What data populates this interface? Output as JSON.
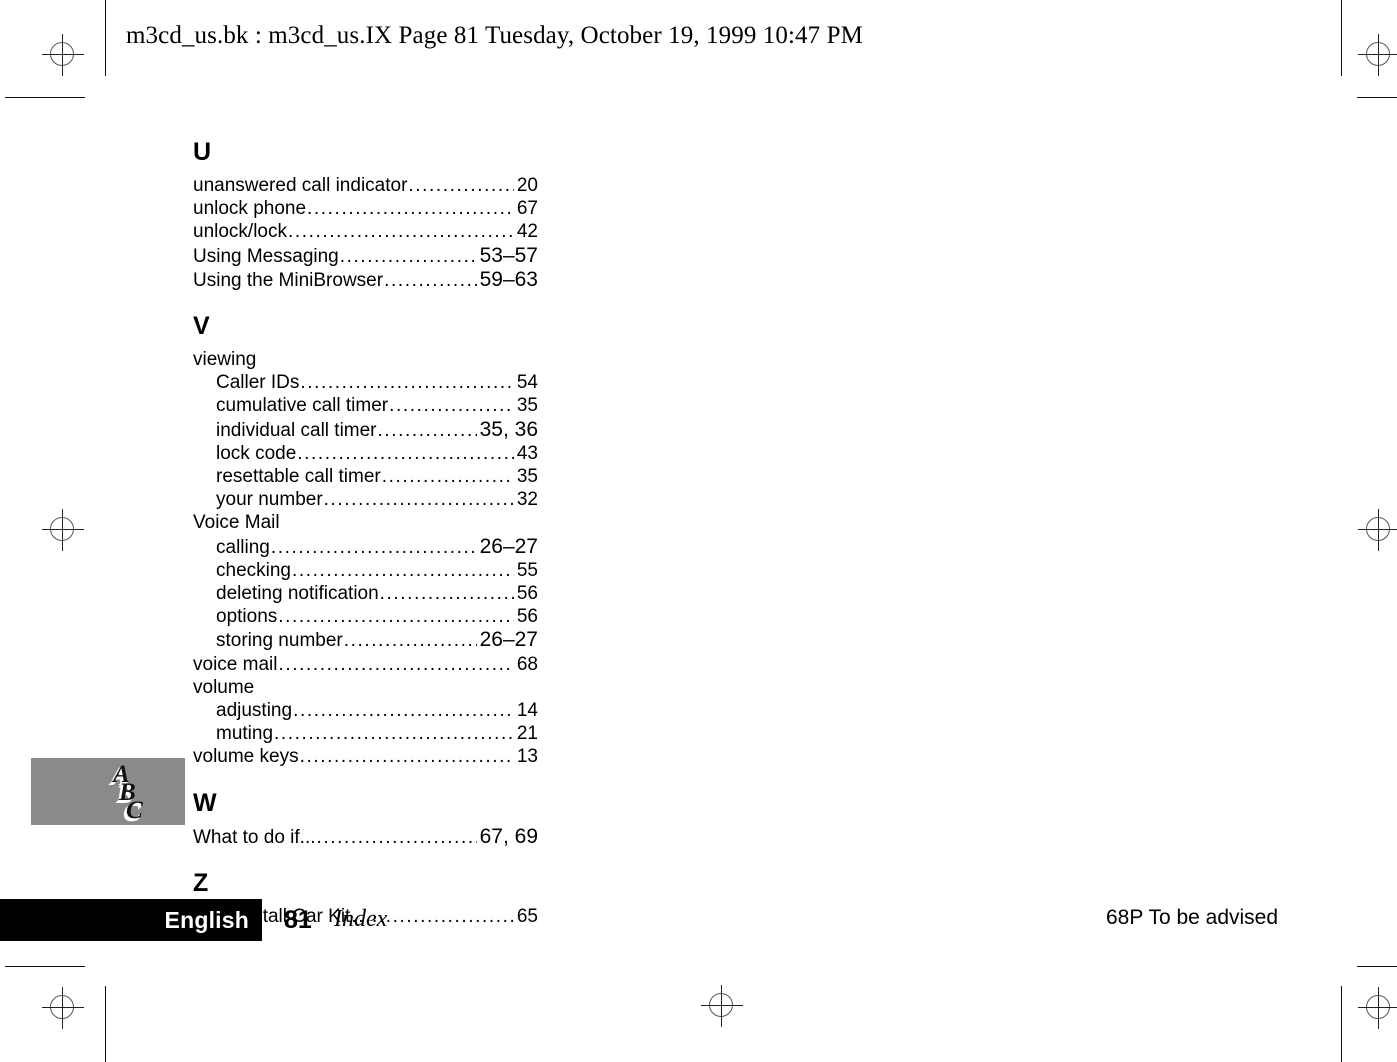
{
  "header": {
    "slug": "m3cd_us.bk : m3cd_us.IX  Page 81  Tuesday, October 19, 1999  10:47 PM"
  },
  "index": {
    "sections": [
      {
        "letter": "U",
        "entries": [
          {
            "text": "unanswered call indicator",
            "pages": "20",
            "level": 0,
            "range": false
          },
          {
            "text": "unlock phone",
            "pages": "67",
            "level": 0,
            "range": false
          },
          {
            "text": "unlock/lock",
            "pages": "42",
            "level": 0,
            "range": false
          },
          {
            "text": "Using Messaging",
            "pages": "53–57",
            "level": 0,
            "range": true
          },
          {
            "text": "Using the MiniBrowser",
            "pages": "59–63",
            "level": 0,
            "range": true
          }
        ]
      },
      {
        "letter": "V",
        "entries": [
          {
            "text": "viewing",
            "pages": "",
            "level": 0,
            "range": false
          },
          {
            "text": "Caller IDs",
            "pages": "54",
            "level": 1,
            "range": false
          },
          {
            "text": "cumulative call timer",
            "pages": "35",
            "level": 1,
            "range": false
          },
          {
            "text": "individual call timer",
            "pages": "35, 36",
            "level": 1,
            "range": true
          },
          {
            "text": "lock code",
            "pages": "43",
            "level": 1,
            "range": false
          },
          {
            "text": "resettable call timer",
            "pages": "35",
            "level": 1,
            "range": false
          },
          {
            "text": "your number",
            "pages": "32",
            "level": 1,
            "range": false
          },
          {
            "text": "Voice Mail",
            "pages": "",
            "level": 0,
            "range": false
          },
          {
            "text": "calling",
            "pages": "26–27",
            "level": 1,
            "range": true
          },
          {
            "text": "checking",
            "pages": "55",
            "level": 1,
            "range": false
          },
          {
            "text": "deleting notification",
            "pages": "56",
            "level": 1,
            "range": false
          },
          {
            "text": "options",
            "pages": "56",
            "level": 1,
            "range": false
          },
          {
            "text": "storing number",
            "pages": "26–27",
            "level": 1,
            "range": true
          },
          {
            "text": "voice mail",
            "pages": "68",
            "level": 0,
            "range": false
          },
          {
            "text": "volume",
            "pages": "",
            "level": 0,
            "range": false
          },
          {
            "text": "adjusting",
            "pages": "14",
            "level": 1,
            "range": false
          },
          {
            "text": "muting",
            "pages": "21",
            "level": 1,
            "range": false
          },
          {
            "text": "volume keys",
            "pages": "13",
            "level": 0,
            "range": false
          }
        ]
      },
      {
        "letter": "W",
        "entries": [
          {
            "text": "What to do if...",
            "pages": "67, 69",
            "level": 0,
            "range": true
          }
        ]
      },
      {
        "letter": "Z",
        "entries": [
          {
            "text": "Zero Install Car Kit",
            "pages": "65",
            "level": 0,
            "range": false
          }
        ]
      }
    ]
  },
  "thumb_tab": {
    "letters": [
      "A",
      "B",
      "C"
    ],
    "background_color": "#8a8a8a"
  },
  "footer": {
    "language": "English",
    "page_number": "81",
    "section_name": "Index",
    "right_note": "68P   To be  advised",
    "bar_color": "#000000"
  },
  "marks": {
    "registration_icon": "registration-target-icon"
  }
}
